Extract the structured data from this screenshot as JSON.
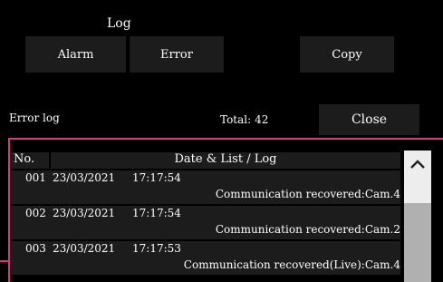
{
  "title": "Log",
  "buttons": {
    "alarm": "Alarm",
    "error": "Error",
    "copy": "Copy",
    "close": "Close"
  },
  "error_log_label": "Error log",
  "total": {
    "label": "Total:",
    "value": "42"
  },
  "table": {
    "headers": {
      "no": "No.",
      "date_log": "Date & List / Log"
    },
    "rows": [
      {
        "no": "001",
        "date": "23/03/2021",
        "time": "17:17:54",
        "message": "Communication recovered:Cam.4"
      },
      {
        "no": "002",
        "date": "23/03/2021",
        "time": "17:17:54",
        "message": "Communication recovered:Cam.2"
      },
      {
        "no": "003",
        "date": "23/03/2021",
        "time": "17:17:53",
        "message": "Communication recovered(Live):Cam.4"
      }
    ]
  },
  "colors": {
    "accent": "#e0357c",
    "button_bg": "#1c1c1c",
    "scrollbar": "#ededed",
    "scroll_thumb": "#b0b0b0"
  },
  "icons": {
    "scroll_up": "chevron-up-icon"
  }
}
